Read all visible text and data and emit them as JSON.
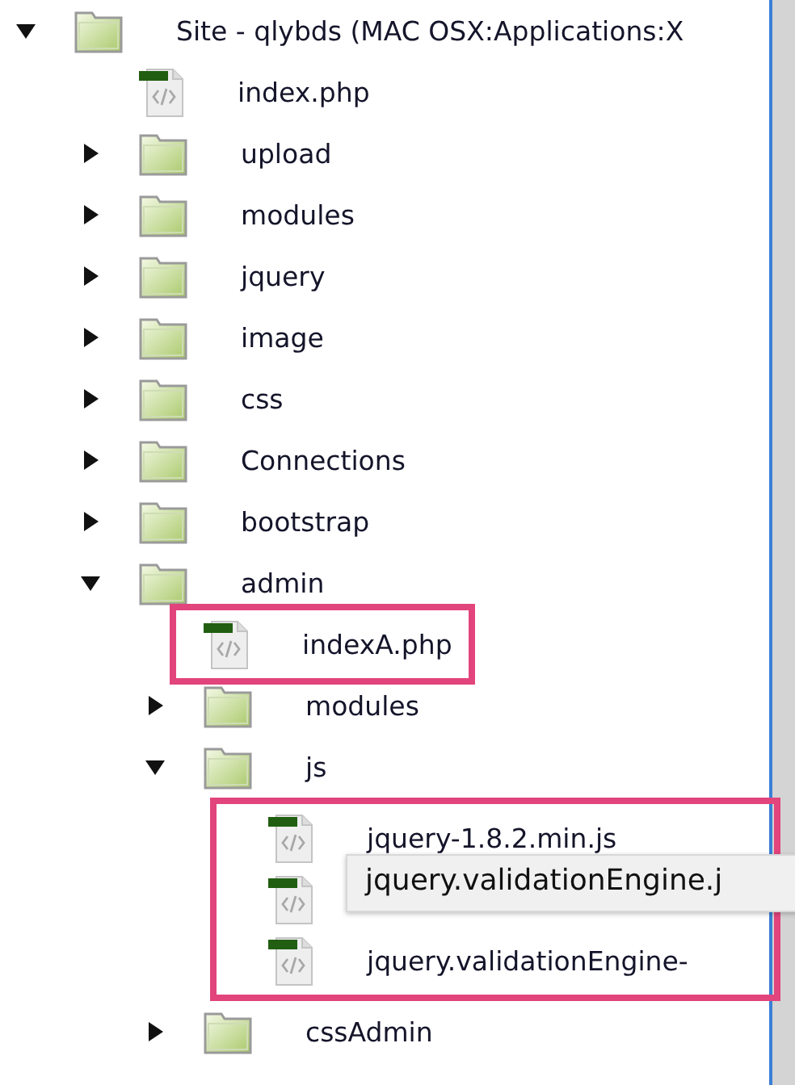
{
  "tree": [
    {
      "name": "Site - qlybds (MAC OSX:Applications:X",
      "kind": "folder",
      "expanded": true,
      "children": [
        {
          "name": "index.php",
          "kind": "file"
        },
        {
          "name": "upload",
          "kind": "folder",
          "expanded": false
        },
        {
          "name": "modules",
          "kind": "folder",
          "expanded": false
        },
        {
          "name": "jquery",
          "kind": "folder",
          "expanded": false
        },
        {
          "name": "image",
          "kind": "folder",
          "expanded": false
        },
        {
          "name": "css",
          "kind": "folder",
          "expanded": false
        },
        {
          "name": "Connections",
          "kind": "folder",
          "expanded": false
        },
        {
          "name": "bootstrap",
          "kind": "folder",
          "expanded": false
        },
        {
          "name": "admin",
          "kind": "folder",
          "expanded": true,
          "children": [
            {
              "name": "indexA.php",
              "kind": "file",
              "highlighted": true
            },
            {
              "name": "modules",
              "kind": "folder",
              "expanded": false
            },
            {
              "name": "js",
              "kind": "folder",
              "expanded": true,
              "children_highlighted": true,
              "children": [
                {
                  "name": "jquery-1.8.2.min.js",
                  "kind": "file"
                },
                {
                  "kind": "file",
                  "tooltip": "jquery.validationEngine.j"
                },
                {
                  "name": "jquery.validationEngine-",
                  "kind": "file"
                }
              ]
            },
            {
              "name": "cssAdmin",
              "kind": "folder",
              "expanded": false
            }
          ]
        }
      ]
    }
  ]
}
